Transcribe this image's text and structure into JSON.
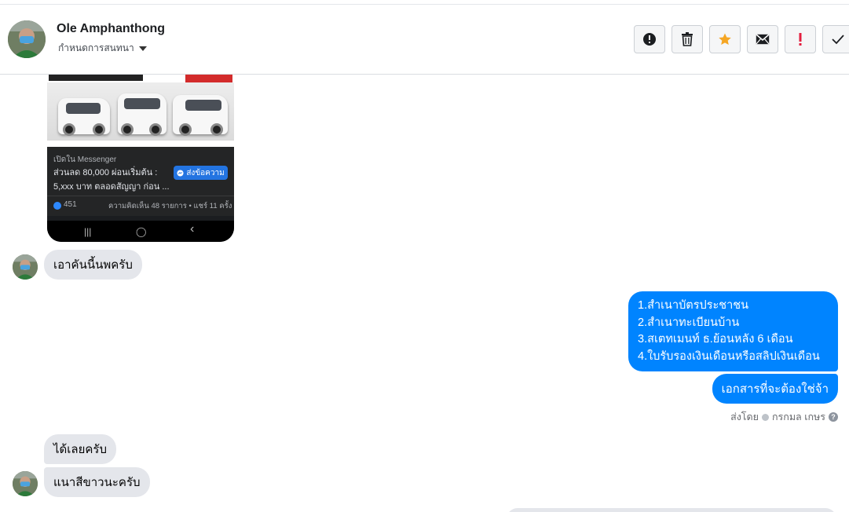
{
  "header": {
    "contact_name": "Ole Amphanthong",
    "contact_subtitle": "กำหนดการสนทนา",
    "actions": [
      {
        "icon": "alert-circle-icon",
        "color": "#1c1e21"
      },
      {
        "icon": "trash-icon",
        "color": "#1c1e21"
      },
      {
        "icon": "star-icon",
        "color": "#f5a623"
      },
      {
        "icon": "envelope-icon",
        "color": "#1c1e21"
      },
      {
        "icon": "exclamation-icon",
        "color": "#e41e3f"
      },
      {
        "icon": "check-icon",
        "color": "#1c1e21"
      }
    ]
  },
  "shared_post": {
    "open_in": "เปิดใน Messenger",
    "text_line1": "ส่วนลด 80,000 ผ่อนเริ่มต้น :",
    "text_line2": "5,xxx บาท ตลอดสัญญา ก่อน ...",
    "send_button": "ส่งข้อความ",
    "like_count": "451",
    "stats": "ความคิดเห็น 48 รายการ • แชร์ 11 ครั้ง",
    "nav_recent": "|||",
    "nav_home": "◯",
    "nav_back": "‹"
  },
  "messages": {
    "in_1": "เอาคันนี้นพครับ",
    "out_list": [
      "1.สำเนาบัตรประชาชน",
      "2.สำเนาทะเบียนบ้าน",
      "3.สเตทเมนท์ ธ.ย้อนหลัง 6 เดือน",
      "4.ใบรับรองเงินเดือนหรือสลิปเงินเดือน"
    ],
    "out_2": "เอกสารที่จะต้องใช่จ้า",
    "sent_by_label": "ส่งโดย",
    "sent_by_name": "กรกมล เกษร",
    "help": "?",
    "in_2": "ได้เลยครับ",
    "in_3": "แนาสีขาวนะครับ"
  },
  "colors": {
    "outgoing_bubble": "#0084ff",
    "incoming_bubble": "#e4e6eb",
    "accent_star": "#f5a623",
    "alert_red": "#e41e3f"
  }
}
